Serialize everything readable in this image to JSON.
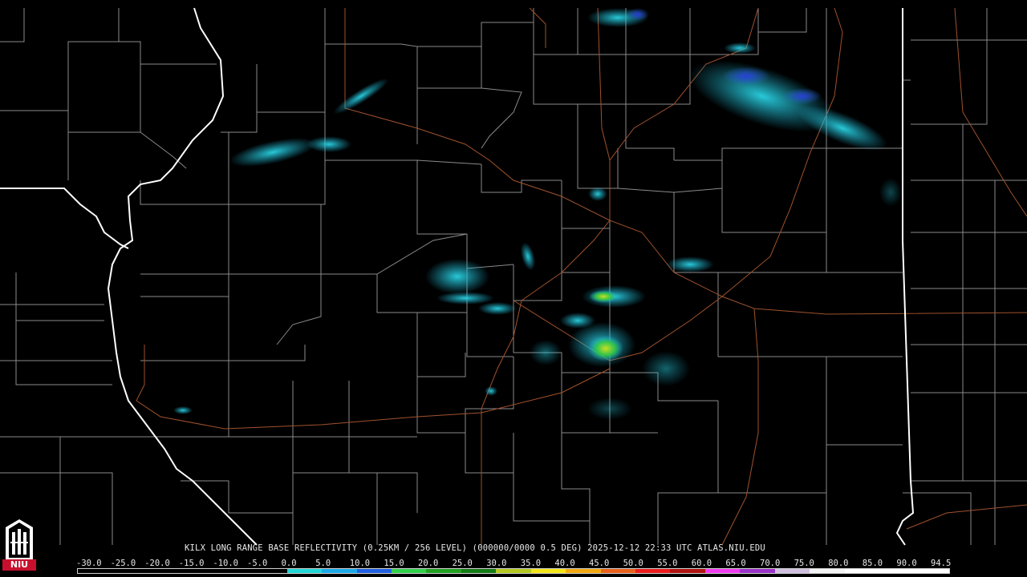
{
  "title": "KILX LONG RANGE BASE REFLECTIVITY (0.25KM / 256 LEVEL) (000000/0000 0.5 DEG) 2025-12-12 22:33 UTC  ATLAS.NIU.EDU",
  "logo": {
    "text": "NIU",
    "icon": "niu-tower-logo",
    "color": "#c8102e"
  },
  "colors": {
    "background": "#000000",
    "county_lines": "#8a8a8a",
    "state_lines": "#ffffff",
    "highways": "#a0522d"
  },
  "color_scale": {
    "labels": [
      "-30.0",
      "-25.0",
      "-20.0",
      "-15.0",
      "-10.0",
      "-5.0",
      "0.0",
      "5.0",
      "10.0",
      "15.0",
      "20.0",
      "25.0",
      "30.0",
      "35.0",
      "40.0",
      "45.0",
      "50.0",
      "55.0",
      "60.0",
      "65.0",
      "70.0",
      "75.0",
      "80.0",
      "85.0",
      "90.0",
      "94.5"
    ],
    "segments": [
      "#000000",
      "#000000",
      "#000000",
      "#000000",
      "#000000",
      "#000000",
      "#1fd5d5",
      "#1aa8e8",
      "#1f5fe0",
      "#2fd04a",
      "#1fa01f",
      "#137a13",
      "#b4c81f",
      "#f2e416",
      "#f0a80f",
      "#e8601a",
      "#ec1c1c",
      "#b01212",
      "#ef3bef",
      "#9a32c8",
      "#d0c0e0",
      "#f4f4f4",
      "#ffffff",
      "#ffffff",
      "#ffffff"
    ]
  }
}
